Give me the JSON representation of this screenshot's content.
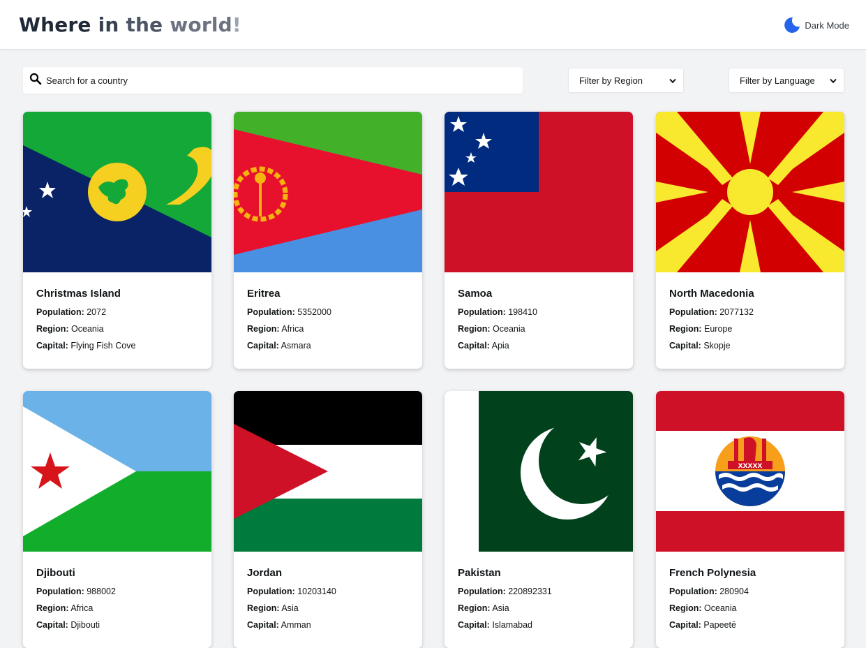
{
  "header": {
    "title_parts": [
      "Where ",
      "in ",
      "the ",
      "world",
      "!"
    ],
    "dark_mode_label": "Dark Mode",
    "dark_mode_icon": "moon-icon"
  },
  "controls": {
    "search_placeholder": "Search for a country",
    "search_icon": "search-icon",
    "region_filter": "Filter by Region",
    "language_filter": "Filter by Language"
  },
  "labels": {
    "population": "Population:",
    "region": "Region:",
    "capital": "Capital:"
  },
  "countries": [
    {
      "name": "Christmas Island",
      "population": "2072",
      "region": "Oceania",
      "capital": "Flying Fish Cove"
    },
    {
      "name": "Eritrea",
      "population": "5352000",
      "region": "Africa",
      "capital": "Asmara"
    },
    {
      "name": "Samoa",
      "population": "198410",
      "region": "Oceania",
      "capital": "Apia"
    },
    {
      "name": "North Macedonia",
      "population": "2077132",
      "region": "Europe",
      "capital": "Skopje"
    },
    {
      "name": "Djibouti",
      "population": "988002",
      "region": "Africa",
      "capital": "Djibouti"
    },
    {
      "name": "Jordan",
      "population": "10203140",
      "region": "Asia",
      "capital": "Amman"
    },
    {
      "name": "Pakistan",
      "population": "220892331",
      "region": "Asia",
      "capital": "Islamabad"
    },
    {
      "name": "French Polynesia",
      "population": "280904",
      "region": "Oceania",
      "capital": "Papeetē"
    }
  ]
}
